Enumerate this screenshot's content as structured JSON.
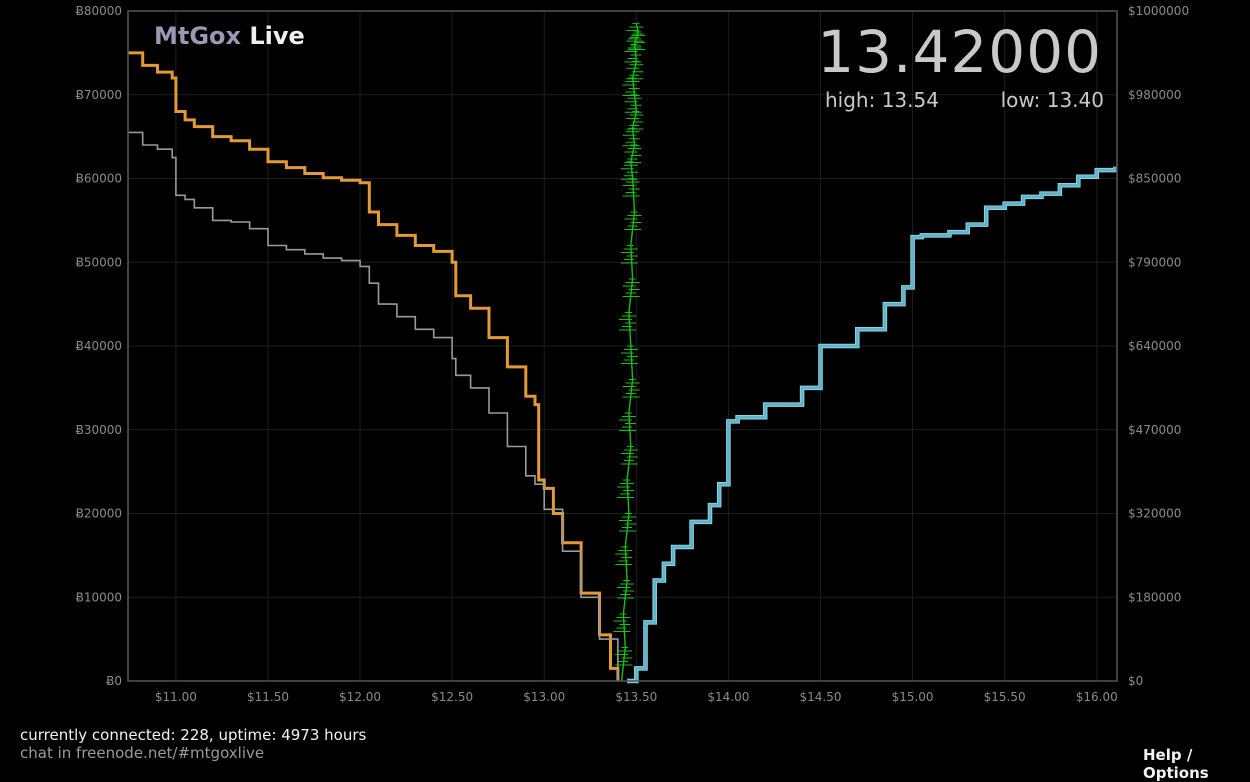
{
  "header": {
    "brand_part1": "MtGox",
    "brand_part2": "Live",
    "price": "13.42000",
    "high": "high: 13.54",
    "low": "low: 13.40"
  },
  "footer": {
    "status": "currently connected: 228, uptime: 4973 hours",
    "chat": "chat in freenode.net/#mtgoxlive",
    "help": "Help / Options"
  },
  "colors": {
    "bids": "#e39a35",
    "asks": "#5fb6cc",
    "bids_btc": "#9a9a9a",
    "trades": "#17c017",
    "grid": "#1e1e1e",
    "frame": "#555555"
  },
  "chart_data": {
    "type": "line",
    "x_ticks": [
      "$11.00",
      "$11.50",
      "$12.00",
      "$12.50",
      "$13.00",
      "$13.50",
      "$14.00",
      "$14.50",
      "$15.00",
      "$15.50",
      "$16.00"
    ],
    "y_left_ticks": [
      "Ƀ0",
      "Ƀ10000",
      "Ƀ20000",
      "Ƀ30000",
      "Ƀ40000",
      "Ƀ50000",
      "Ƀ60000",
      "Ƀ70000",
      "Ƀ80000"
    ],
    "y_right_ticks": [
      "$0",
      "$180000",
      "$320000",
      "$470000",
      "$640000",
      "$790000",
      "$850000",
      "$980000",
      "$1000000"
    ],
    "xlim": [
      10.74,
      16.11
    ],
    "ylim_left": [
      0,
      80000
    ],
    "series": [
      {
        "role": "bids-usd",
        "x": [
          10.74,
          10.82,
          10.9,
          10.98,
          11.0,
          11.05,
          11.1,
          11.2,
          11.3,
          11.4,
          11.5,
          11.6,
          11.7,
          11.8,
          11.9,
          12.0,
          12.05,
          12.1,
          12.2,
          12.3,
          12.4,
          12.5,
          12.52,
          12.6,
          12.7,
          12.8,
          12.9,
          12.95,
          12.97,
          13.0,
          13.05,
          13.1,
          13.2,
          13.3,
          13.36,
          13.4
        ],
        "y": [
          75000,
          73500,
          72700,
          72000,
          68000,
          67000,
          66200,
          65000,
          64500,
          63500,
          62000,
          61300,
          60600,
          60100,
          59800,
          59500,
          56000,
          54500,
          53200,
          52000,
          51300,
          50000,
          46000,
          44500,
          41000,
          37500,
          34000,
          33000,
          24000,
          23000,
          20000,
          16500,
          10500,
          5500,
          1500,
          0
        ]
      },
      {
        "role": "bids-btc",
        "x": [
          10.74,
          10.82,
          10.9,
          10.98,
          11.0,
          11.05,
          11.1,
          11.2,
          11.3,
          11.4,
          11.5,
          11.6,
          11.7,
          11.8,
          11.9,
          12.0,
          12.05,
          12.1,
          12.2,
          12.3,
          12.4,
          12.5,
          12.52,
          12.6,
          12.7,
          12.8,
          12.9,
          12.95,
          13.0,
          13.1,
          13.2,
          13.3,
          13.4
        ],
        "y": [
          65500,
          64000,
          63500,
          62500,
          58000,
          57500,
          56500,
          55000,
          54800,
          54000,
          52000,
          51500,
          51000,
          50500,
          50200,
          49500,
          47500,
          45000,
          43500,
          42000,
          41000,
          38500,
          36500,
          35000,
          32000,
          28000,
          24500,
          23500,
          20500,
          15500,
          10000,
          5000,
          0
        ]
      },
      {
        "role": "asks",
        "x": [
          13.45,
          13.5,
          13.55,
          13.6,
          13.65,
          13.7,
          13.8,
          13.9,
          13.95,
          14.0,
          14.05,
          14.2,
          14.4,
          14.5,
          14.7,
          14.85,
          14.95,
          15.0,
          15.05,
          15.2,
          15.3,
          15.4,
          15.5,
          15.6,
          15.7,
          15.8,
          15.9,
          16.0,
          16.1
        ],
        "y": [
          0,
          1500,
          7000,
          12000,
          14000,
          16000,
          19000,
          21000,
          23500,
          31000,
          31500,
          33000,
          35000,
          40000,
          42000,
          45000,
          47000,
          53000,
          53200,
          53600,
          54500,
          56500,
          57000,
          57800,
          58200,
          59200,
          60200,
          61000,
          61400
        ]
      },
      {
        "role": "trades",
        "x": [
          13.42,
          13.44,
          13.43,
          13.45,
          13.44,
          13.46,
          13.45,
          13.47,
          13.46,
          13.48,
          13.47,
          13.46,
          13.48,
          13.47,
          13.49,
          13.48,
          13.47,
          13.49,
          13.48,
          13.5,
          13.49,
          13.48,
          13.5,
          13.49,
          13.51,
          13.5
        ],
        "y": [
          0,
          4000,
          8000,
          12000,
          16000,
          20000,
          24000,
          28000,
          32000,
          36000,
          40000,
          44000,
          48000,
          52000,
          56000,
          60000,
          62000,
          64000,
          66000,
          68000,
          70000,
          72000,
          74000,
          76000,
          77500,
          78500
        ]
      }
    ]
  }
}
